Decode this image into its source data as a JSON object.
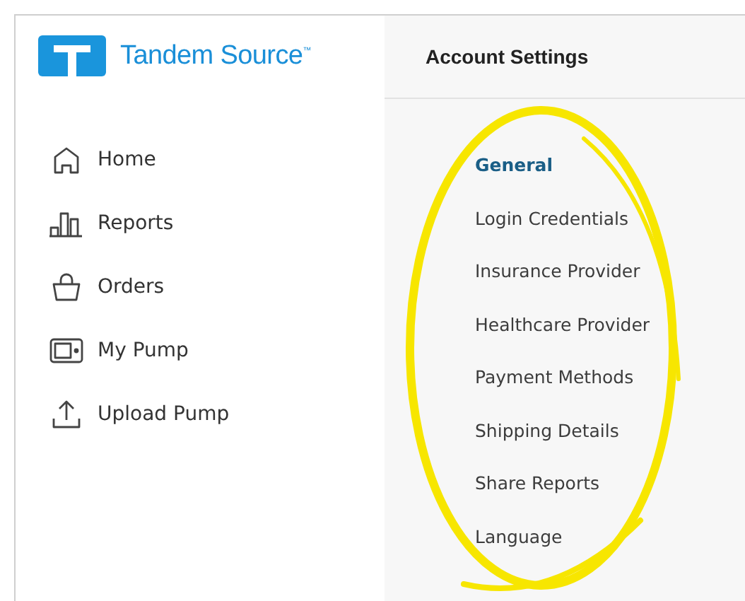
{
  "brand": {
    "name": "Tandem Source$^{™}$"
  },
  "nav": [
    {
      "label": "Home",
      "kind": "home"
    },
    {
      "label": "Reports",
      "kind": "reports"
    },
    {
      "label": "Orders",
      "kind": "orders"
    },
    {
      "label": "My Pump",
      "kind": "pump"
    },
    {
      "label": "Upload Pump",
      "kind": "upload"
    }
  ],
  "settings": {
    "title": "Account Settings",
    "items": [
      {
        "label": "General",
        "selected": true
      },
      {
        "label": "Login Credentials",
        "selected": false
      },
      {
        "label": "Insurance Provider",
        "selected": false
      },
      {
        "label": "Healthcare Provider",
        "selected": false
      },
      {
        "label": "Payment Methods",
        "selected": false
      },
      {
        "label": "Shipping Details",
        "selected": false
      },
      {
        "label": "Share Reports",
        "selected": false
      },
      {
        "label": "Language",
        "selected": false
      }
    ]
  }
}
